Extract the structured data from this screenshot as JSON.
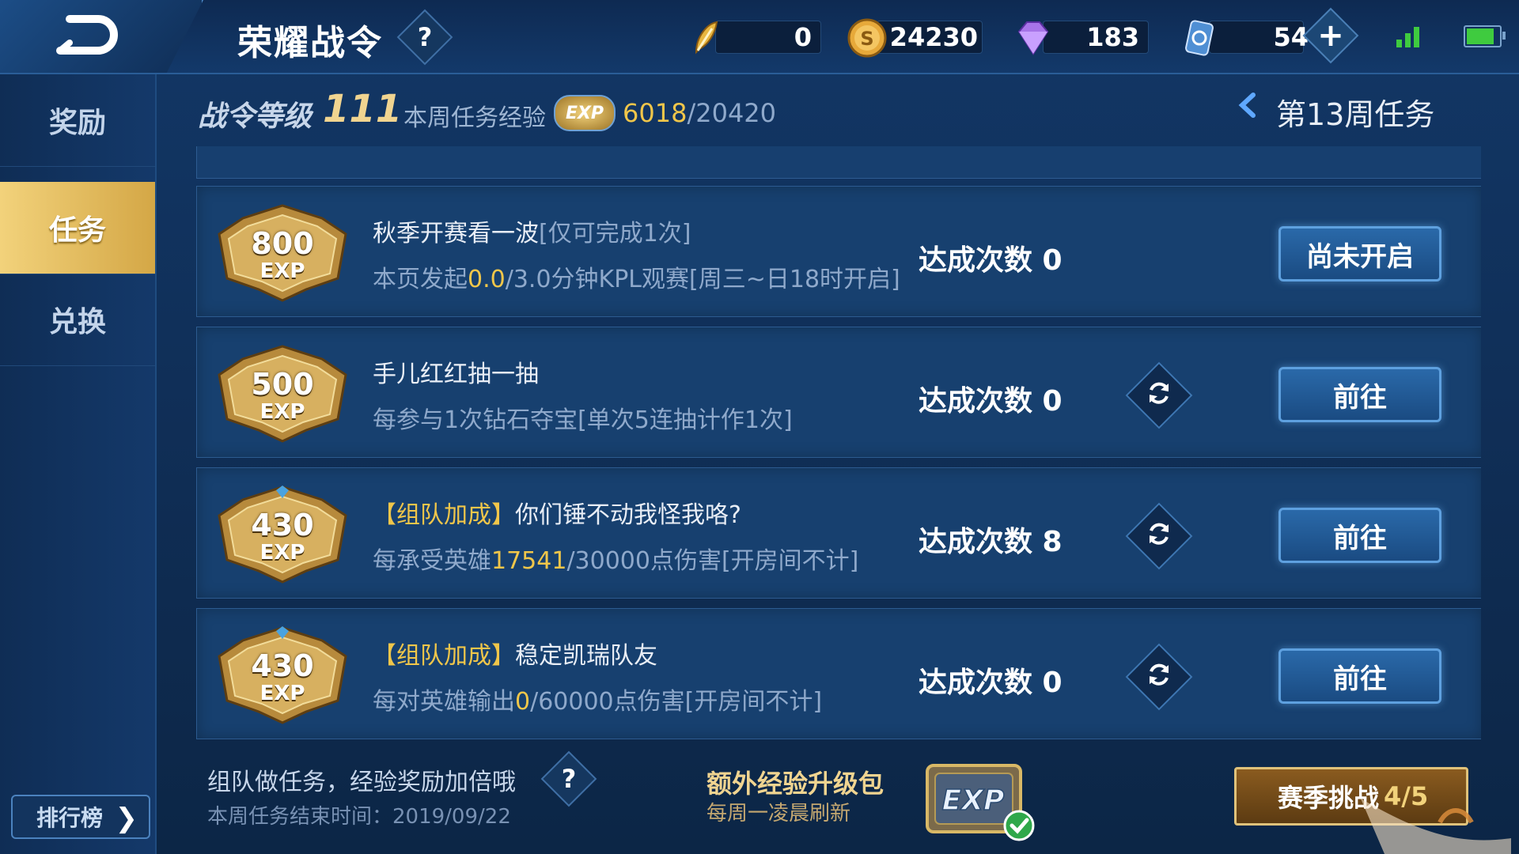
{
  "header": {
    "title": "荣耀战令",
    "resources": [
      {
        "icon": "feather-token-icon",
        "value": "0"
      },
      {
        "icon": "gold-coin-icon",
        "value": "24230"
      },
      {
        "icon": "diamond-icon",
        "value": "183"
      },
      {
        "icon": "voucher-icon",
        "value": "54"
      }
    ],
    "battery_level": 0.85
  },
  "sidebar": {
    "items": [
      {
        "label": "奖励",
        "active": false
      },
      {
        "label": "任务",
        "active": true
      },
      {
        "label": "兑换",
        "active": false
      }
    ],
    "ranking_label": "排行榜"
  },
  "level_bar": {
    "level_label": "战令等级",
    "level_value": "111",
    "week_exp_label": "本周任务经验",
    "exp_badge": "EXP",
    "exp_current": "6018",
    "exp_total": "/20420",
    "week_tasks_label": "第13周任务"
  },
  "tasks": [
    {
      "exp": "800",
      "exp_unit": "EXP",
      "tag": "",
      "title": "秋季开赛看一波",
      "note": "[仅可完成1次]",
      "desc_pre": "本页发起",
      "desc_hl": "0.0",
      "desc_post": "/3.0分钟KPL观赛[周三~日18时开启]",
      "count_label": "达成次数 0",
      "button": "尚未开启"
    },
    {
      "exp": "500",
      "exp_unit": "EXP",
      "tag": "",
      "title": "手儿红红抽一抽",
      "note": "",
      "desc_pre": "每参与1次钻石夺宝[单次5连抽计作1次]",
      "desc_hl": "",
      "desc_post": "",
      "count_label": "达成次数 0",
      "button": "前往"
    },
    {
      "exp": "430",
      "exp_unit": "EXP",
      "tag": "【组队加成】",
      "title": "你们锤不动我怪我咯?",
      "note": "",
      "desc_pre": "每承受英雄",
      "desc_hl": "17541",
      "desc_post": "/30000点伤害[开房间不计]",
      "count_label": "达成次数 8",
      "button": "前往"
    },
    {
      "exp": "430",
      "exp_unit": "EXP",
      "tag": "【组队加成】",
      "title": "稳定凯瑞队友",
      "note": "",
      "desc_pre": "每对英雄输出",
      "desc_hl": "0",
      "desc_post": "/60000点伤害[开房间不计]",
      "count_label": "达成次数 0",
      "button": "前往"
    }
  ],
  "footer": {
    "team_hint": "组队做任务，经验奖励加倍哦",
    "week_end": "本周任务结束时间：2019/09/22",
    "pack_title": "额外经验升级包",
    "pack_sub": "每周一凌晨刷新",
    "pack_icon_text": "EXP",
    "season_button": "赛季挑战",
    "season_progress": "4/5"
  },
  "colors": {
    "accent_gold": "#f0c64a",
    "button_blue": "#2a69a9",
    "active_nav": "#d4a746"
  }
}
